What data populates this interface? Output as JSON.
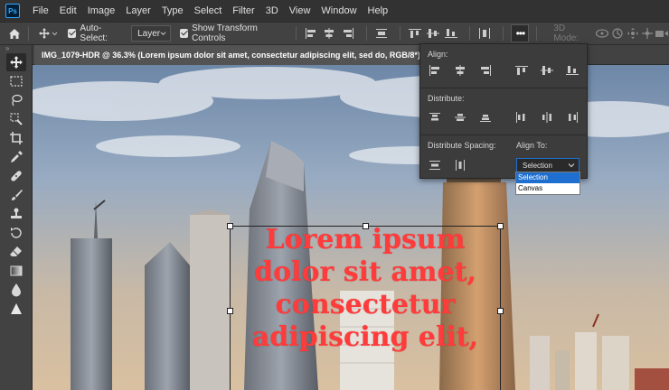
{
  "menu": {
    "logo": "Ps",
    "items": [
      "File",
      "Edit",
      "Image",
      "Layer",
      "Type",
      "Select",
      "Filter",
      "3D",
      "View",
      "Window",
      "Help"
    ]
  },
  "options_bar": {
    "auto_select_label": "Auto-Select:",
    "auto_select_checked": true,
    "layer_select_value": "Layer",
    "show_transform_label": "Show Transform Controls",
    "show_transform_checked": true,
    "more_label": "•••",
    "mode_3d_label": "3D Mode:"
  },
  "document": {
    "tab_title": "IMG_1079-HDR @ 36.3% (Lorem ipsum dolor sit amet, consectetur adipiscing elit, sed do, RGB/8*) *"
  },
  "align_panel": {
    "align_label": "Align:",
    "distribute_label": "Distribute:",
    "distribute_spacing_label": "Distribute Spacing:",
    "align_to_label": "Align To:",
    "align_to_value": "Selection",
    "align_to_options": [
      "Selection",
      "Canvas"
    ],
    "align_to_selected_index": 0
  },
  "canvas_text": {
    "content": "Lorem ipsum\ndolor sit amet,\nconsectetur\nadipiscing elit,",
    "color": "#ff3b3b"
  },
  "colors": {
    "menubar_bg": "#323232",
    "panel_bg": "#424242",
    "accent": "#1e6fd0"
  },
  "icons": {
    "toolbar": [
      "move-icon",
      "marquee-icon",
      "lasso-icon",
      "quick-select-icon",
      "crop-icon",
      "eyedropper-icon",
      "healing-brush-icon",
      "brush-icon",
      "clone-stamp-icon",
      "history-brush-icon",
      "eraser-icon",
      "gradient-icon",
      "blur-icon",
      "dodge-icon"
    ]
  }
}
